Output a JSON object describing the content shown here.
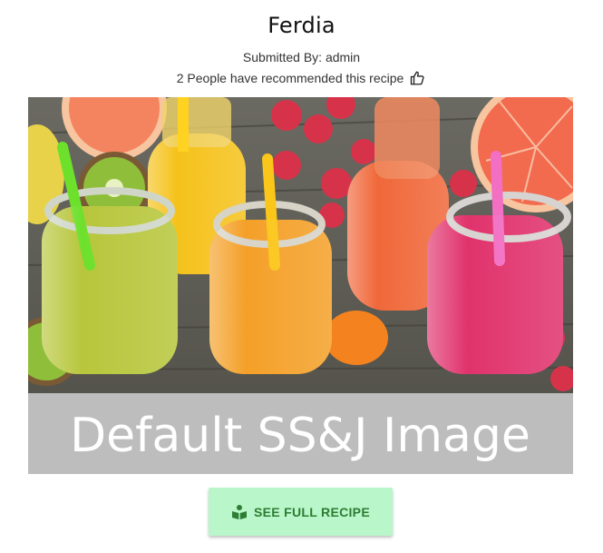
{
  "recipe": {
    "title": "Ferdia",
    "submitted_by": "Submitted By: admin",
    "recommend_text": "2 People have recommended this recipe",
    "thumb_icon": "thumbs-up-icon"
  },
  "image": {
    "caption": "Default SS&J Image",
    "banner_color": "#bdbdbd",
    "bg_color": "#5b5a52"
  },
  "button": {
    "label": "SEE FULL RECIPE",
    "icon": "book-reader-icon",
    "bg_color": "#b9f6ca",
    "text_color": "#2e7d32"
  }
}
